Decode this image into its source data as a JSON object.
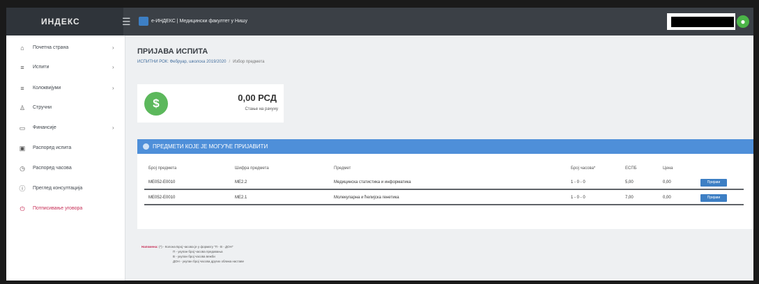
{
  "header": {
    "brand": "ИНДЕКС",
    "app_title": "e-ИНДЕКС | Медицински факултет у Нишу"
  },
  "sidebar": {
    "items": [
      {
        "label": "Почетна страна",
        "icon": "home-icon",
        "chevron": true,
        "active": false
      },
      {
        "label": "Испити",
        "icon": "list-icon",
        "chevron": true,
        "active": false
      },
      {
        "label": "Колоквијуми",
        "icon": "list-icon",
        "chevron": true,
        "active": false
      },
      {
        "label": "Стручни",
        "icon": "user-icon",
        "chevron": false,
        "active": false
      },
      {
        "label": "Финансије",
        "icon": "wallet-icon",
        "chevron": true,
        "active": false
      },
      {
        "label": "Распоред испита",
        "icon": "calendar-icon",
        "chevron": false,
        "active": false
      },
      {
        "label": "Распоред часова",
        "icon": "clock-icon",
        "chevron": false,
        "active": false
      },
      {
        "label": "Преглед консултација",
        "icon": "info-icon",
        "chevron": false,
        "active": false
      },
      {
        "label": "Потписивање уговора",
        "icon": "power-icon",
        "chevron": false,
        "active": true
      }
    ]
  },
  "page": {
    "title": "ПРИЈАВА ИСПИТА",
    "breadcrumb_link": "ИСПИТНИ РОК: Фебруар, школска 2019/2020",
    "breadcrumb_current": "Избор предмета"
  },
  "balance": {
    "amount": "0,00 РСД",
    "label": "Стање на рачуну",
    "icon": "dollar-icon"
  },
  "subjects_panel": {
    "title": "ПРЕДМЕТИ КОЈЕ ЈЕ МОГУЋЕ ПРИЈАВИТИ",
    "columns": [
      "Број предмета",
      "Шифра предмета",
      "Предмет",
      "Број часова*",
      "ЕСПБ",
      "Цена",
      ""
    ],
    "rows": [
      {
        "cells": [
          "МЕ052-Е0010",
          "МЕ2.2",
          "Медицинска статистика и информатика",
          "1 - 0 - 0",
          "5,00",
          "0,00"
        ],
        "action": "Пријави"
      },
      {
        "cells": [
          "МЕ052-Е0010",
          "МЕ2.1",
          "Молекуларна и ћелијска генетика",
          "1 - 0 - 0",
          "7,00",
          "0,00"
        ],
        "action": "Пријави"
      }
    ]
  },
  "note": {
    "lead": "Напомена:",
    "lines": [
      "(*) - Колона Број часова је у формату \"П - В - ДОН\"",
      "П - укупан број часова предавања",
      "В - укупан број часова вежби",
      "ДОН - укупан број часова других облика наставе"
    ]
  }
}
